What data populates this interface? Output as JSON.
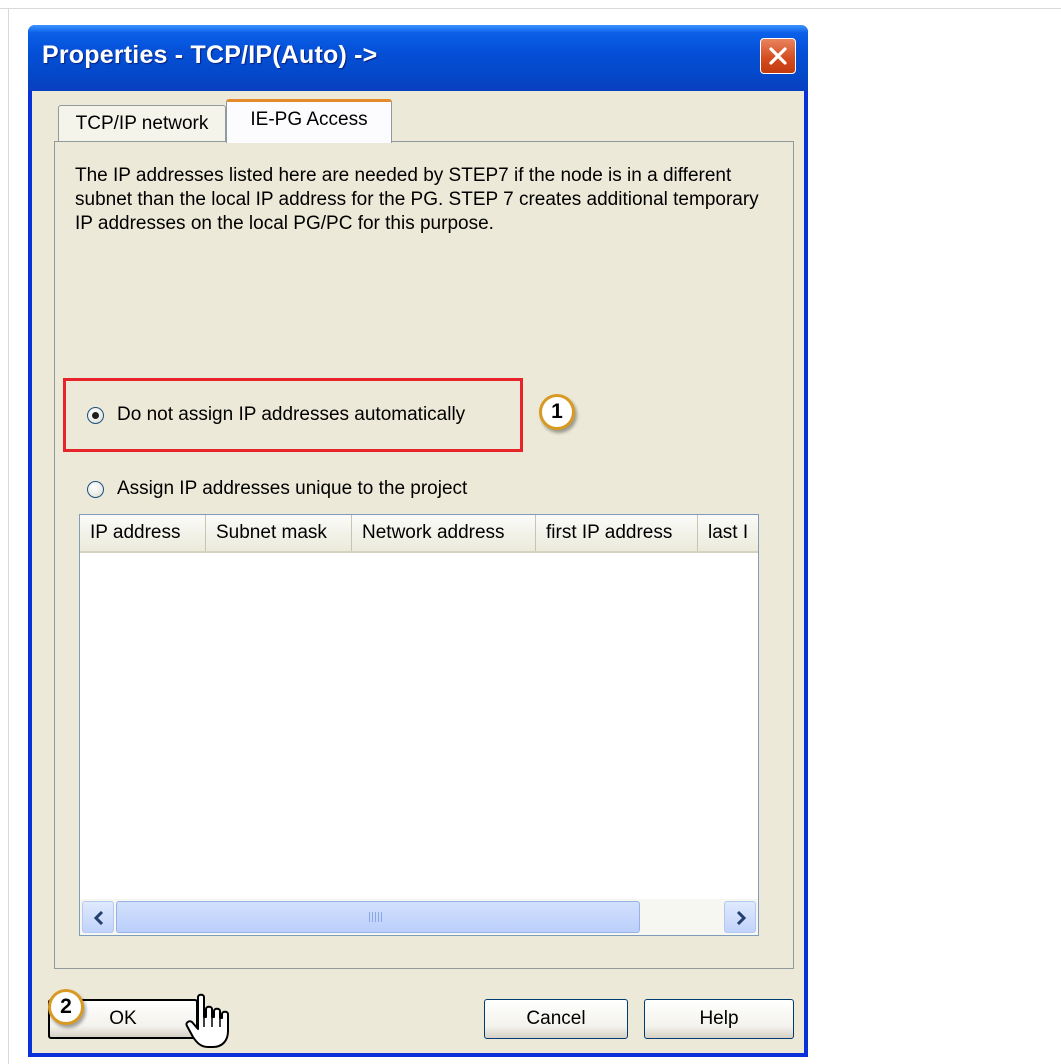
{
  "window": {
    "title": "Properties - TCP/IP(Auto) ->",
    "close_icon": "close-icon"
  },
  "tabs": [
    {
      "label": "TCP/IP network",
      "active": false
    },
    {
      "label": "IE-PG Access",
      "active": true
    }
  ],
  "description": "The IP addresses listed here are needed by STEP7 if the node is in a different subnet than the local IP address for the PG. STEP 7 creates additional temporary IP addresses on the local PG/PC for this purpose.",
  "options": {
    "no_assign": {
      "label": "Do not assign IP addresses automatically",
      "selected": true
    },
    "unique": {
      "label": "Assign IP addresses unique to the project",
      "selected": false
    }
  },
  "table": {
    "columns": [
      "IP address",
      "Subnet mask",
      "Network address",
      "first IP address",
      "last I"
    ],
    "rows": []
  },
  "buttons": {
    "ok": "OK",
    "cancel": "Cancel",
    "help": "Help"
  },
  "annotations": {
    "step1": "1",
    "step2": "2"
  },
  "colors": {
    "highlight": "#e8242b",
    "titlebar": "#0550d8",
    "face": "#ece9d8"
  }
}
